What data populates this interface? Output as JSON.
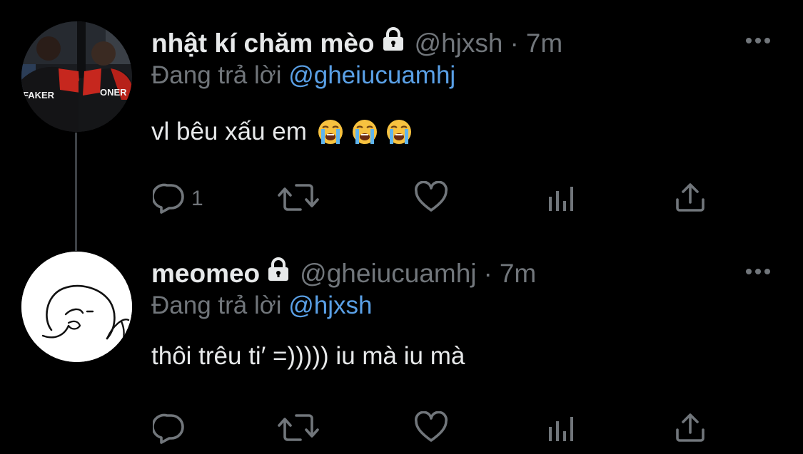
{
  "tweets": [
    {
      "display_name": "nhật kí chăm mèo",
      "handle": "@hjxsh",
      "separator": "·",
      "time": "7m",
      "reply_prefix": "Đang trả lời",
      "reply_mention": "@gheiucuamhj",
      "text": "vl bêu xấu em",
      "emoji": [
        "loudly-crying-face",
        "loudly-crying-face",
        "loudly-crying-face"
      ],
      "avatar_labels": [
        "FAKER",
        "ONER"
      ],
      "reply_count": "1"
    },
    {
      "display_name": "meomeo",
      "handle": "@gheiucuamhj",
      "separator": "·",
      "time": "7m",
      "reply_prefix": "Đang trả lời",
      "reply_mention": "@hjxsh",
      "text": "thôi trêu ti′ =))))) iu mà iu mà",
      "reply_count": ""
    }
  ],
  "icons": {
    "lock": "lock-icon",
    "more": "more-horizontal-icon",
    "reply": "reply-icon",
    "retweet": "retweet-icon",
    "like": "heart-icon",
    "stats": "analytics-icon",
    "share": "share-icon"
  },
  "colors": {
    "background": "#000000",
    "primary_text": "#e7e9ea",
    "secondary_text": "#71767b",
    "link": "#5aa0e6",
    "thread_line": "#3d4146"
  }
}
